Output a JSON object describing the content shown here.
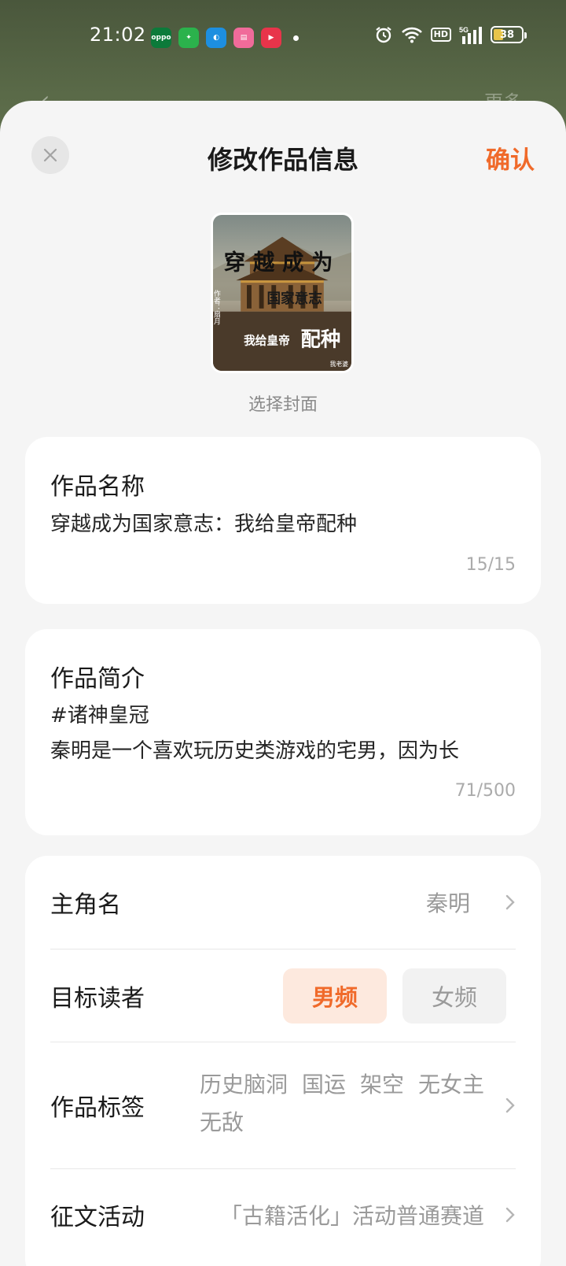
{
  "status_bar": {
    "time": "21:02",
    "battery": "38",
    "hd": "HD",
    "network": "5G"
  },
  "behind": {
    "back_glyph": "‹",
    "more_label": "更多"
  },
  "header": {
    "close_glyph": "✕",
    "title": "修改作品信息",
    "confirm_label": "确认"
  },
  "cover": {
    "select_label": "选择封面",
    "art_title_top": "穿越成为",
    "art_title_mid": "国家意志",
    "art_title_bottom_a": "我给皇帝",
    "art_title_bottom_b": "配种",
    "art_author": "作者：扇月",
    "art_corner": "我老婆"
  },
  "name_card": {
    "label": "作品名称",
    "value": "穿越成为国家意志：我给皇帝配种",
    "counter": "15/15"
  },
  "intro_card": {
    "label": "作品简介",
    "line1": "#诸神皇冠",
    "line2": "秦明是一个喜欢玩历史类游戏的宅男，因为长",
    "counter": "71/500"
  },
  "settings": {
    "protagonist_label": "主角名",
    "protagonist_value": "秦明",
    "reader_label": "目标读者",
    "reader_options": [
      "男频",
      "女频"
    ],
    "reader_selected": "男频",
    "tags_label": "作品标签",
    "tags": [
      "历史脑洞",
      "国运",
      "架空",
      "无女主",
      "无敌"
    ],
    "contest_label": "征文活动",
    "contest_value": "「古籍活化」活动普通赛道"
  },
  "colors": {
    "accent": "#f06a2a",
    "accent_bg": "#fde9de",
    "sheet_bg": "#f5f5f5"
  }
}
